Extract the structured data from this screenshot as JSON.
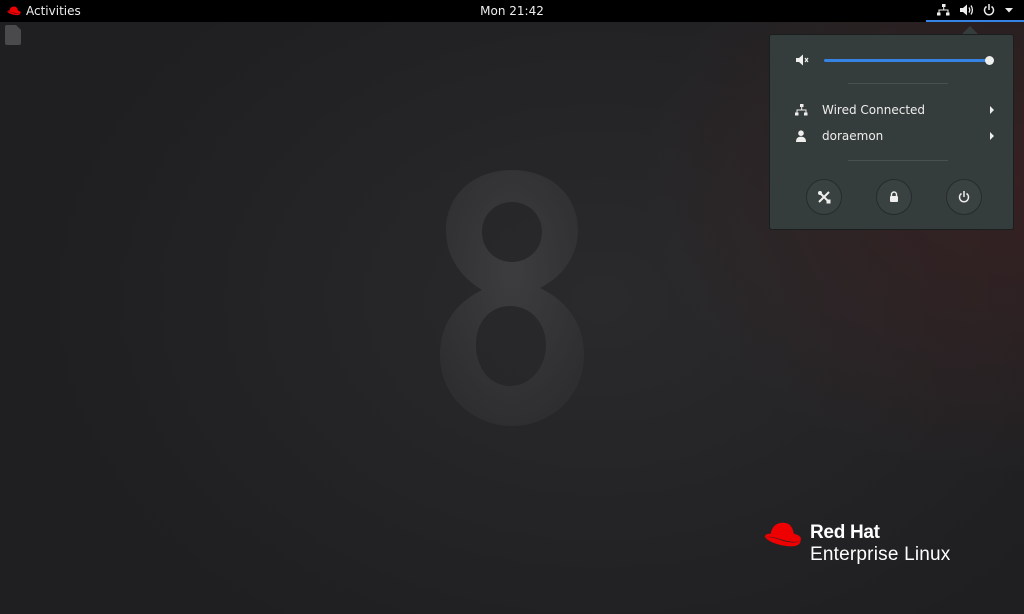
{
  "topbar": {
    "activities_label": "Activities",
    "clock": "Mon 21:42"
  },
  "tray": {
    "icons": [
      "network-wired-icon",
      "audio-volume-icon",
      "power-icon",
      "dropdown-arrow-icon"
    ]
  },
  "system_menu": {
    "volume_percent": 100,
    "items": [
      {
        "icon": "network-wired-icon",
        "label": "Wired Connected"
      },
      {
        "icon": "user-icon",
        "label": "doraemon"
      }
    ],
    "actions": [
      "settings-icon",
      "lock-icon",
      "power-off-icon"
    ]
  },
  "branding": {
    "logo_line1": "Red Hat",
    "logo_line2": "Enterprise Linux"
  },
  "colors": {
    "accent": "#3584e4",
    "redhat_red": "#ee0000",
    "panel_bg": "#000000",
    "popover_bg": "#353c3c"
  }
}
